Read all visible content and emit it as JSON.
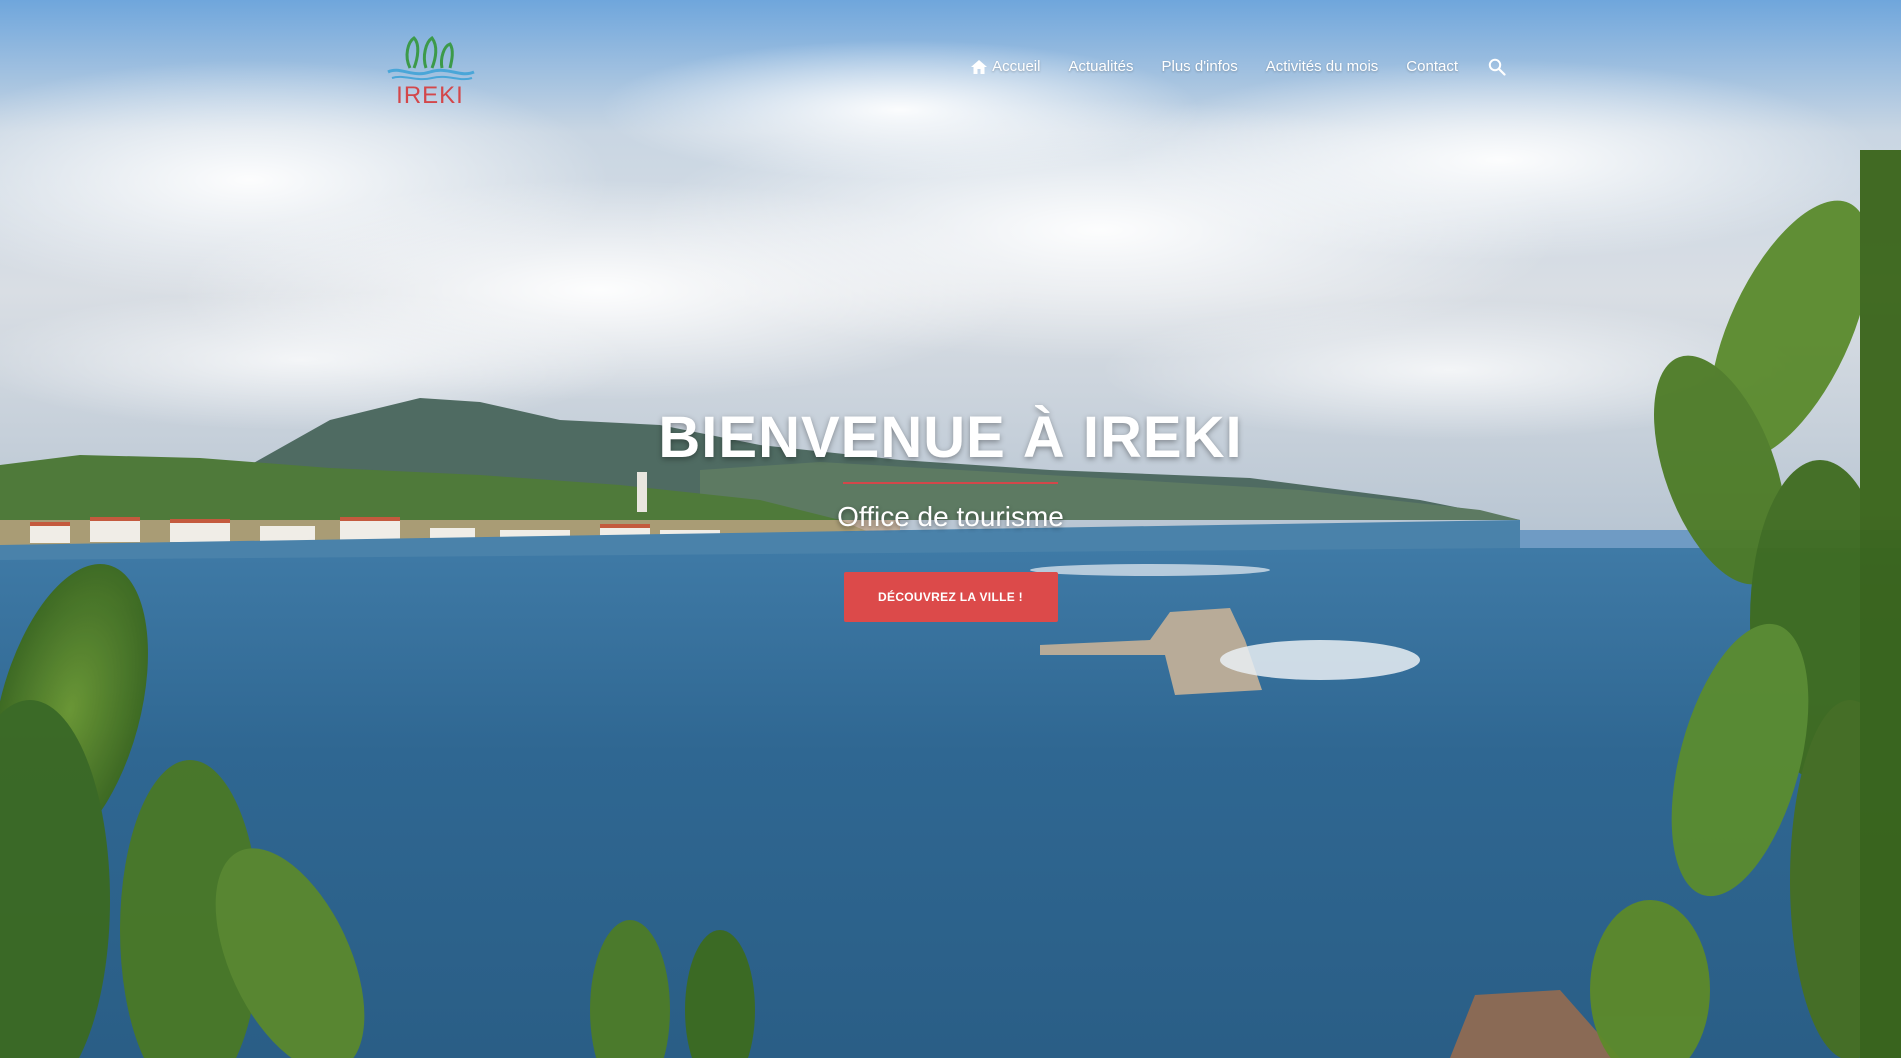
{
  "brand": {
    "name": "IREKI",
    "accent_color": "#d3474a"
  },
  "nav": {
    "items": [
      {
        "label": "Accueil",
        "icon": "home-icon",
        "active": true
      },
      {
        "label": "Actualités"
      },
      {
        "label": "Plus d'infos"
      },
      {
        "label": "Activités du mois"
      },
      {
        "label": "Contact"
      }
    ],
    "search_icon": "search-icon"
  },
  "hero": {
    "title": "BIENVENUE À IREKI",
    "subtitle": "Office de tourisme",
    "cta_label": "DÉCOUVREZ LA VILLE !",
    "cta_color": "#dc4a4a"
  }
}
